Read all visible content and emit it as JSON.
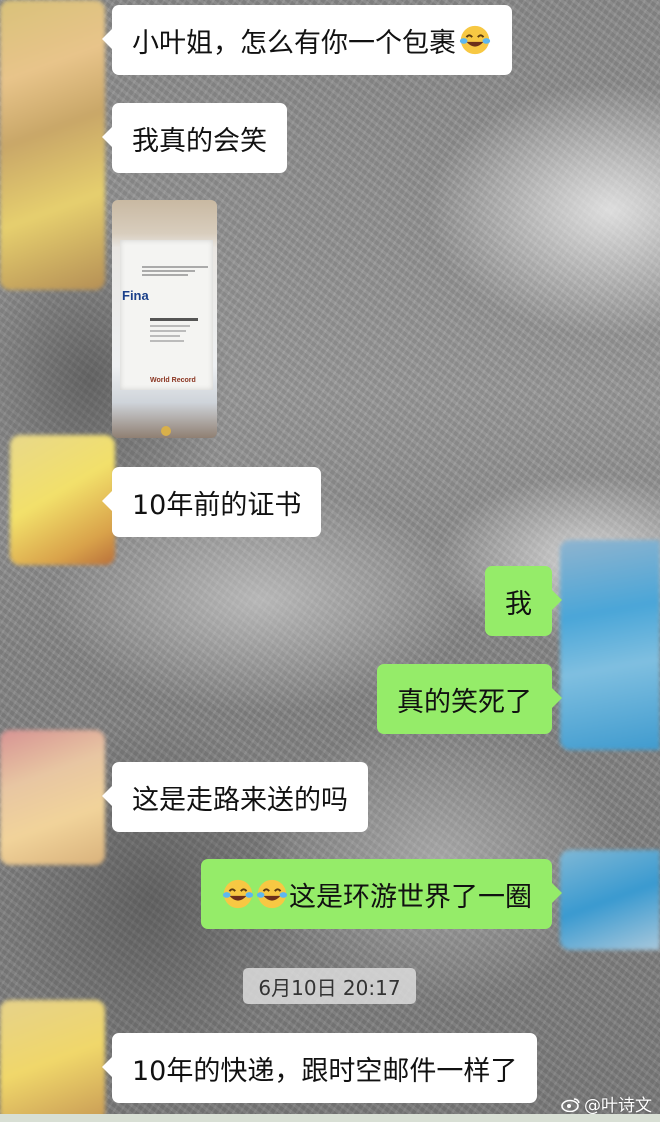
{
  "chat": {
    "messages": [
      {
        "side": "in",
        "text": "小叶姐，怎么有你一个包裹"
      },
      {
        "side": "in",
        "text": "我真的会笑"
      },
      {
        "side": "in",
        "type": "image",
        "image_text": {
          "logo": "Fina",
          "record": "World Record"
        }
      },
      {
        "side": "in",
        "text": "10年前的证书"
      },
      {
        "side": "out",
        "text": "我"
      },
      {
        "side": "out",
        "text": "真的笑死了"
      },
      {
        "side": "in",
        "text": "这是走路来送的吗"
      },
      {
        "side": "out",
        "text": "这是环游世界了一圈",
        "leading_emoji": "face-with-tears-of-joy-icon"
      },
      {
        "side": "in",
        "text": "10年的快递，跟时空邮件一样了"
      }
    ],
    "timestamp": "6月10日 20:17"
  },
  "watermark": {
    "text": "@叶诗文",
    "icon": "weibo-icon"
  },
  "colors": {
    "incoming_bubble": "#ffffff",
    "outgoing_bubble": "#95ec69"
  }
}
